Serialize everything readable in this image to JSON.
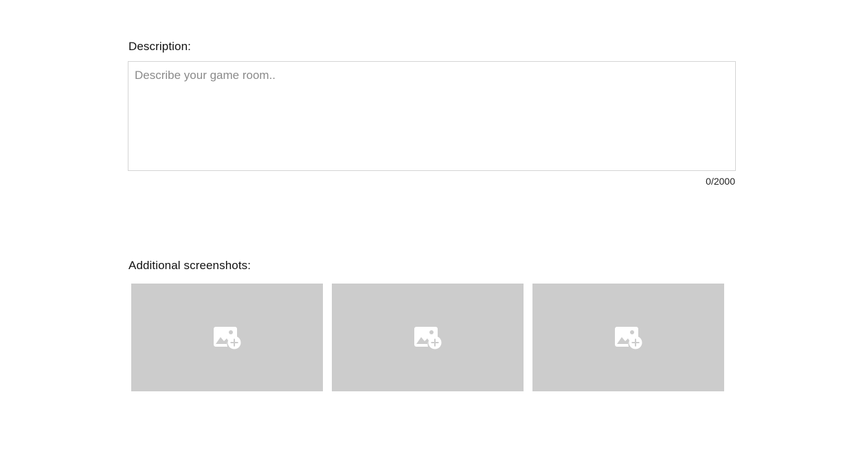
{
  "description": {
    "label": "Description:",
    "placeholder": "Describe your game room..",
    "value": "",
    "counter": "0/2000"
  },
  "screenshots": {
    "label": "Additional screenshots:",
    "tiles": [
      {
        "icon": "add-image-icon"
      },
      {
        "icon": "add-image-icon"
      },
      {
        "icon": "add-image-icon"
      }
    ]
  },
  "colors": {
    "tile_bg": "#cccccc",
    "icon": "#ffffff",
    "border": "#d4d4d4"
  }
}
